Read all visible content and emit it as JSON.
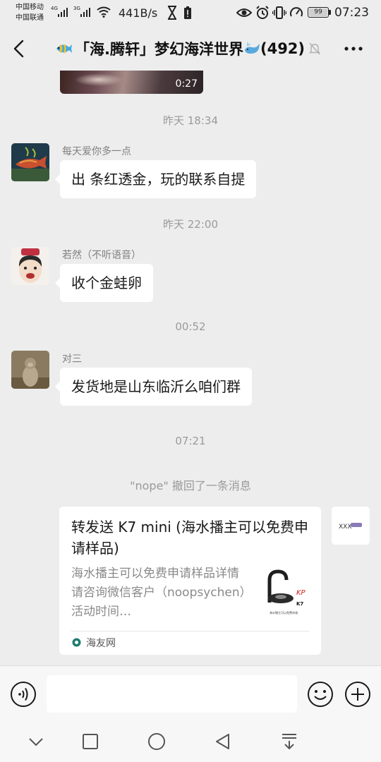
{
  "status_bar": {
    "carrier_1": "中国移动",
    "carrier_2": "中国联通",
    "net_gen_1": "4G",
    "net_gen_2": "3G",
    "net_speed": "441B/s",
    "battery": "99",
    "time": "07:23"
  },
  "header": {
    "title": "「海.腾轩」梦幻海洋世界",
    "member_count": "(492)",
    "icons": {
      "back": "chevron-left-icon",
      "more": "more-dots-icon",
      "title_left": "fish-emoji-icon",
      "title_right": "whale-emoji-icon",
      "mute": "mute-bell-icon"
    }
  },
  "chat": {
    "video_duration": "0:27",
    "messages": [
      {
        "time": "昨天 18:34",
        "sender": "每天爱你多一点",
        "text": "出 条红透金，玩的联系自提"
      },
      {
        "time": "昨天 22:00",
        "sender": "若然（不听语音）",
        "text": "收个金蛙卵"
      },
      {
        "time": "00:52",
        "sender": "对三",
        "text": "发货地是山东临沂么咱们群"
      }
    ],
    "time_4": "07:21",
    "recall_notice": "\"nope\" 撤回了一条消息",
    "card": {
      "title": "转发送 K7 mini (海水播主可以免费申请样品)",
      "description": "海水播主可以免费申请样品详情请咨询微信客户（noopsychen）活动时间…",
      "source": "海友网",
      "thumb_brand": "KP",
      "thumb_model": "K7",
      "thumb_caption": "海水播主可以免费申请",
      "self_avatar_label": "XXX"
    }
  },
  "input_bar": {
    "placeholder": ""
  },
  "colors": {
    "background": "#ededed",
    "bubble": "#ffffff",
    "meta_text": "#9a9a9a",
    "accent_green": "#07c160"
  }
}
